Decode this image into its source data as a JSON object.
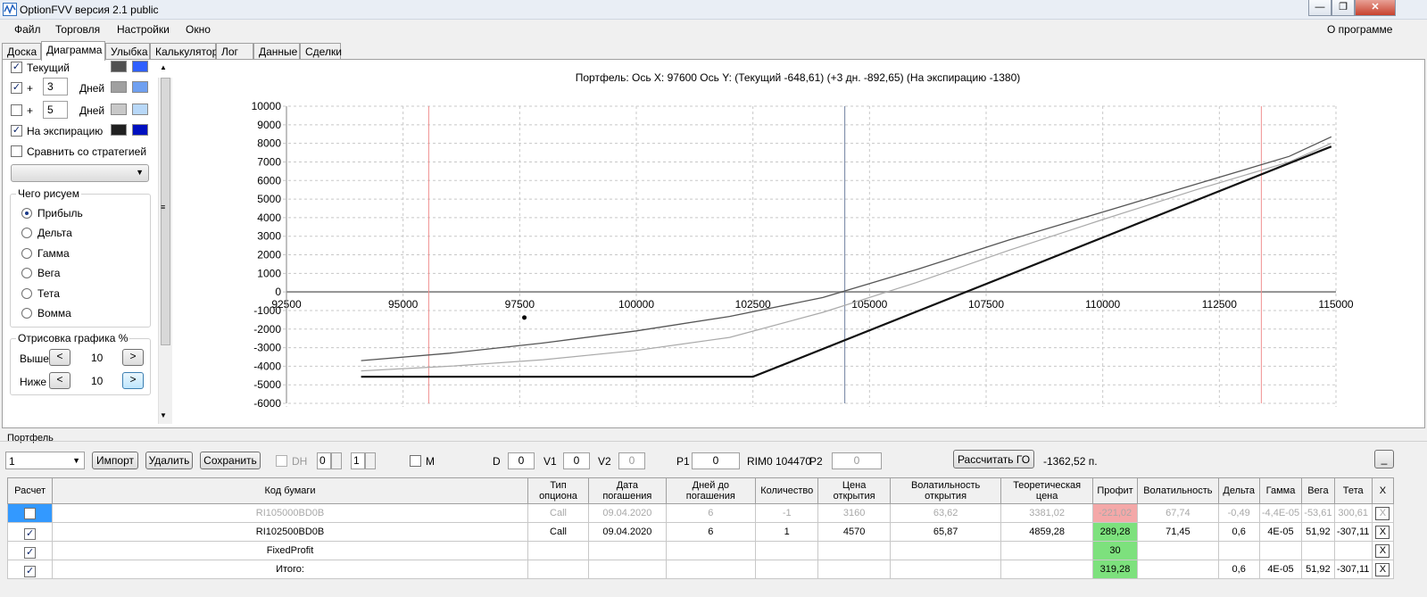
{
  "window": {
    "title": "OptionFVV версия 2.1 public"
  },
  "menu": {
    "items": [
      "Файл",
      "Торговля",
      "Настройки",
      "Окно"
    ],
    "about": "О программе"
  },
  "tabs": [
    "Доска",
    "Диаграмма",
    "Улыбка",
    "Калькулятор",
    "Лог",
    "Данные",
    "Сделки"
  ],
  "left_panel": {
    "current_label": "Текущий",
    "plus_sign": "+",
    "days1": "3",
    "days2": "5",
    "days_label": "Дней",
    "expiry_label": "На экспирацию",
    "compare_label": "Сравнить со стратегией",
    "what_group": "Чего рисуем",
    "radios": [
      "Прибыль",
      "Дельта",
      "Гамма",
      "Вега",
      "Тета",
      "Вомма"
    ],
    "render_group": "Отрисовка графика %",
    "above_label": "Выше",
    "below_label": "Ниже",
    "above_value": "10",
    "below_value": "10",
    "arrow_left": "<",
    "arrow_right": ">",
    "colors": {
      "current_a": "#505050",
      "current_b": "#3060ff",
      "d3_a": "#a0a0a0",
      "d3_b": "#70a0f0",
      "d5_a": "#c8c8c8",
      "d5_b": "#b8d8f8",
      "exp_a": "#202020",
      "exp_b": "#0010c0"
    }
  },
  "chart_header": {
    "text": "Портфель: Ось X: 97600 Ось Y:  (Текущий -648,61)  (+3 дн. -892,65)  (На экспирацию -1380)"
  },
  "chart_data": {
    "type": "line",
    "xlim": [
      92500,
      115000
    ],
    "ylim": [
      -6000,
      10000
    ],
    "x_ticks": [
      "92500",
      "95000",
      "97500",
      "100000",
      "102500",
      "105000",
      "107500",
      "110000",
      "112500",
      "115000"
    ],
    "y_ticks": [
      "10000",
      "9000",
      "8000",
      "7000",
      "6000",
      "5000",
      "4000",
      "3000",
      "2000",
      "1000",
      "0",
      "-1000",
      "-2000",
      "-3000",
      "-4000",
      "-5000",
      "-6000"
    ],
    "vlines": [
      {
        "x": 95550,
        "color": "#f09090"
      },
      {
        "x": 104470,
        "color": "#7080a0"
      },
      {
        "x": 113400,
        "color": "#f09090"
      }
    ],
    "marker": {
      "x": 97600,
      "y": -1380
    },
    "series": [
      {
        "color": "#555555",
        "width": 1.3,
        "points": [
          [
            94100,
            -3700
          ],
          [
            96000,
            -3300
          ],
          [
            98000,
            -2750
          ],
          [
            100000,
            -2100
          ],
          [
            102000,
            -1320
          ],
          [
            104000,
            -300
          ],
          [
            106000,
            1200
          ],
          [
            108000,
            2800
          ],
          [
            110000,
            4300
          ],
          [
            112000,
            5800
          ],
          [
            114000,
            7300
          ],
          [
            114900,
            8350
          ]
        ]
      },
      {
        "color": "#aaaaaa",
        "width": 1.2,
        "points": [
          [
            94100,
            -4250
          ],
          [
            96000,
            -4000
          ],
          [
            98000,
            -3650
          ],
          [
            100000,
            -3150
          ],
          [
            102000,
            -2450
          ],
          [
            104000,
            -1100
          ],
          [
            106000,
            500
          ],
          [
            108000,
            2250
          ],
          [
            110000,
            3900
          ],
          [
            112000,
            5500
          ],
          [
            114000,
            7000
          ],
          [
            114900,
            8000
          ]
        ]
      },
      {
        "color": "#111111",
        "width": 2.2,
        "points": [
          [
            94100,
            -4570
          ],
          [
            102500,
            -4570
          ],
          [
            114900,
            7830
          ]
        ]
      }
    ]
  },
  "portfolio": {
    "label": "Портфель",
    "selector": "1",
    "import": "Импорт",
    "delete": "Удалить",
    "save": "Сохранить",
    "dh": "DH",
    "dh_v1": "0",
    "dh_v2": "1",
    "m": "M",
    "d_label": "D",
    "d_val": "0",
    "v1_label": "V1",
    "v1_val": "0",
    "v2_label": "V2",
    "v2_val": "0",
    "p1_label": "P1",
    "p1_val": "0",
    "rim": "RIM0 104470",
    "p2_label": "P2",
    "p2_val": "0",
    "calc_go": "Рассчитать ГО",
    "go_value": "-1362,52 п.",
    "minimize": "_"
  },
  "table": {
    "headers": [
      "Расчет",
      "Код бумаги",
      "Тип опциона",
      "Дата погашения",
      "Дней до погашения",
      "Количество",
      "Цена открытия",
      "Волатильность открытия",
      "Теоретическая цена",
      "Профит",
      "Волатильность",
      "Дельта",
      "Гамма",
      "Вега",
      "Тета",
      "X"
    ],
    "rows": [
      {
        "checked": false,
        "cells": [
          "RI105000BD0B",
          "Call",
          "09.04.2020",
          "6",
          "-1",
          "3160",
          "63,62",
          "3381,02",
          "-221,02",
          "67,74",
          "-0,49",
          "-4,4E-05",
          "-53,61",
          "300,61"
        ]
      },
      {
        "checked": true,
        "cells": [
          "RI102500BD0B",
          "Call",
          "09.04.2020",
          "6",
          "1",
          "4570",
          "65,87",
          "4859,28",
          "289,28",
          "71,45",
          "0,6",
          "4E-05",
          "51,92",
          "-307,11"
        ]
      },
      {
        "checked": true,
        "cells": [
          "FixedProfit",
          "",
          "",
          "",
          "",
          "",
          "",
          "",
          "30",
          "",
          "",
          "",
          "",
          ""
        ]
      },
      {
        "checked": true,
        "cells": [
          "Итого:",
          "",
          "",
          "",
          "",
          "",
          "",
          "",
          "319,28",
          "",
          "0,6",
          "4E-05",
          "51,92",
          "-307,11"
        ]
      }
    ],
    "close_symbol": "X"
  }
}
